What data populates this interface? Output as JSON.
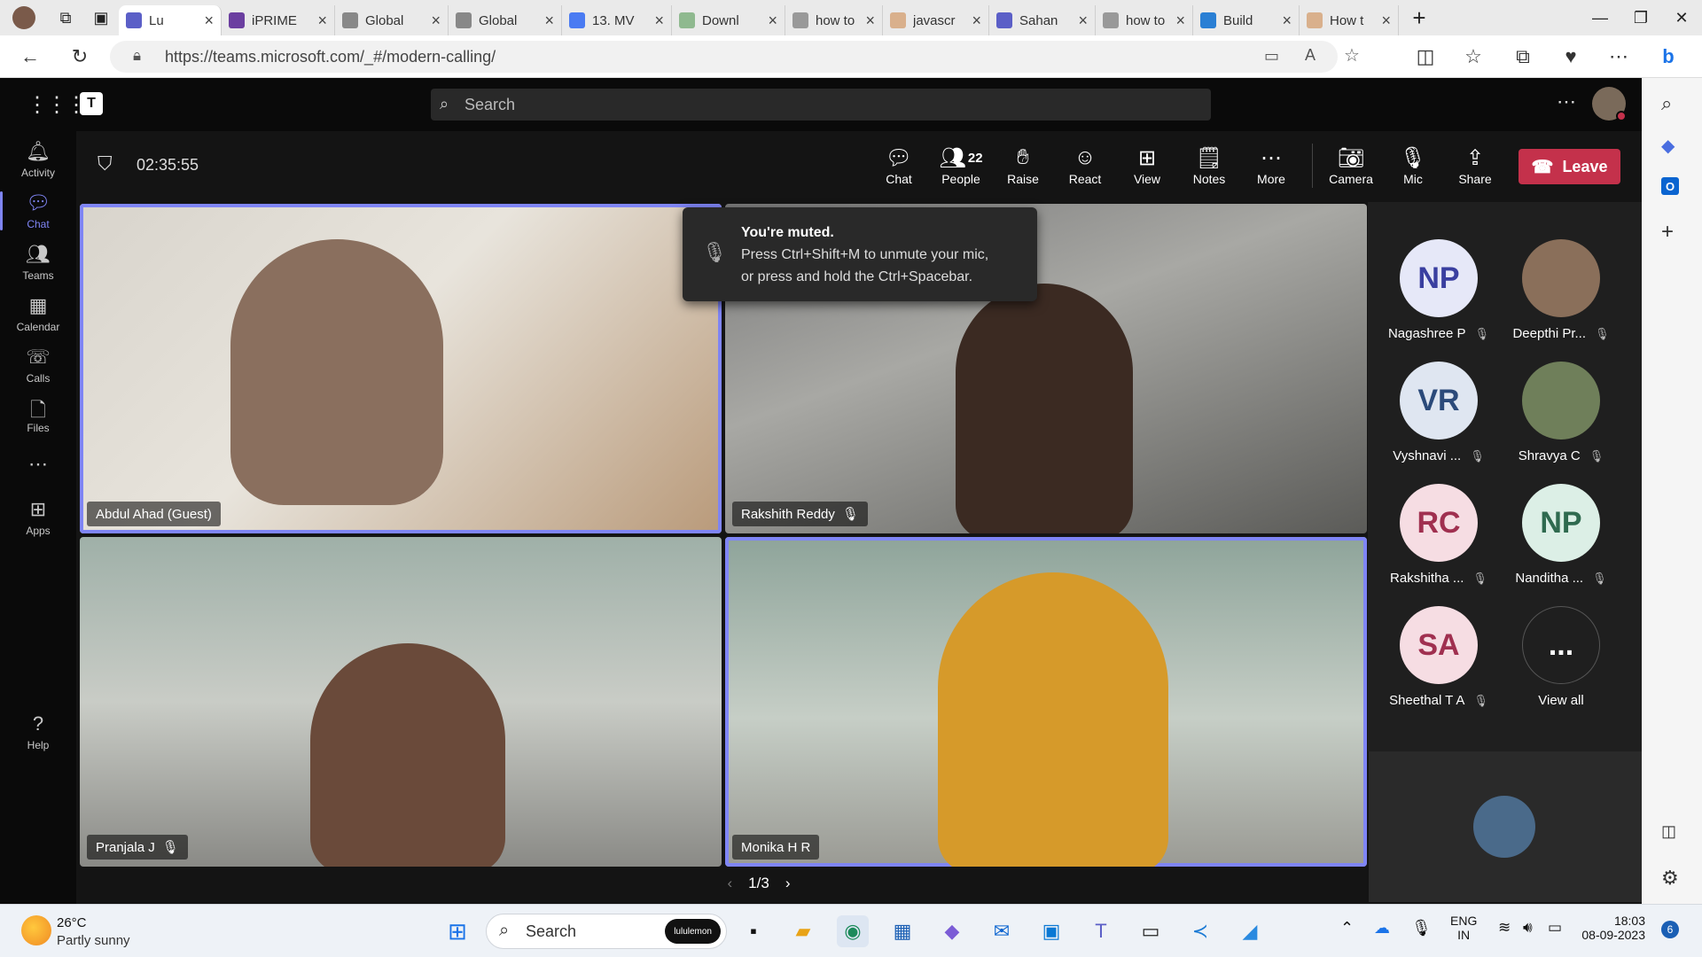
{
  "browser": {
    "tabs": [
      {
        "title": "Lu",
        "color": "#5b5fc7"
      },
      {
        "title": "iPRIME",
        "color": "#6b3fa0"
      },
      {
        "title": "Global",
        "color": "#888888"
      },
      {
        "title": "Global",
        "color": "#888888"
      },
      {
        "title": "13. MV",
        "color": "#4a7bf2"
      },
      {
        "title": "Downl",
        "color": "#8fb98f"
      },
      {
        "title": "how to",
        "color": "#999999"
      },
      {
        "title": "javascr",
        "color": "#d9b08c"
      },
      {
        "title": "Sahan",
        "color": "#5b5fc7"
      },
      {
        "title": "how to",
        "color": "#999999"
      },
      {
        "title": "Build",
        "color": "#2a7fd4"
      },
      {
        "title": "How t",
        "color": "#d9b08c"
      }
    ],
    "url": "https://teams.microsoft.com/_#/modern-calling/"
  },
  "teams": {
    "search_placeholder": "Search",
    "rail": [
      {
        "label": "Activity",
        "icon": "bell-icon"
      },
      {
        "label": "Chat",
        "icon": "chat-icon"
      },
      {
        "label": "Teams",
        "icon": "teams-icon"
      },
      {
        "label": "Calendar",
        "icon": "calendar-icon"
      },
      {
        "label": "Calls",
        "icon": "phone-icon"
      },
      {
        "label": "Files",
        "icon": "file-icon"
      },
      {
        "label": "...",
        "icon": "more-icon"
      },
      {
        "label": "Apps",
        "icon": "apps-icon"
      },
      {
        "label": "Help",
        "icon": "help-icon"
      }
    ]
  },
  "meeting": {
    "timer": "02:35:55",
    "controls": {
      "chat": "Chat",
      "people": "People",
      "people_count": "22",
      "raise": "Raise",
      "react": "React",
      "view": "View",
      "notes": "Notes",
      "more": "More",
      "camera": "Camera",
      "mic": "Mic",
      "share": "Share",
      "leave": "Leave"
    },
    "tiles": [
      {
        "name": "Abdul Ahad (Guest)"
      },
      {
        "name": "Rakshith Reddy"
      },
      {
        "name": "Pranjala J"
      },
      {
        "name": "Monika H R"
      }
    ],
    "toast": {
      "title": "You're muted.",
      "body_line1": "Press Ctrl+Shift+M to unmute your mic,",
      "body_line2": "or press and hold the Ctrl+Spacebar."
    },
    "pager": "1/3",
    "roster": [
      {
        "initials": "NP",
        "name": "Nagashree P",
        "bg": "#e6e8f8",
        "fg": "#3a3fa0"
      },
      {
        "initials": "",
        "name": "Deepthi Pr...",
        "bg": "#8a6f5a",
        "fg": "#ffffff"
      },
      {
        "initials": "VR",
        "name": "Vyshnavi ...",
        "bg": "#dfe6f1",
        "fg": "#2b4a7a"
      },
      {
        "initials": "",
        "name": "Shravya C",
        "bg": "#6f7f5a",
        "fg": "#ffffff"
      },
      {
        "initials": "RC",
        "name": "Rakshitha ...",
        "bg": "#f6dde3",
        "fg": "#a03050"
      },
      {
        "initials": "NP",
        "name": "Nanditha ...",
        "bg": "#dcefe6",
        "fg": "#2f6a4f"
      },
      {
        "initials": "SA",
        "name": "Sheethal T A",
        "bg": "#f6dde3",
        "fg": "#a03050"
      },
      {
        "initials": "...",
        "name": "View all",
        "bg": "#1f1f1f",
        "fg": "#ffffff"
      }
    ]
  },
  "taskbar": {
    "weather_temp": "26°C",
    "weather_desc": "Partly sunny",
    "search_placeholder": "Search",
    "search_badge": "lululemon",
    "lang1": "ENG",
    "lang2": "IN",
    "time": "18:03",
    "date": "08-09-2023",
    "notif_count": "6"
  }
}
